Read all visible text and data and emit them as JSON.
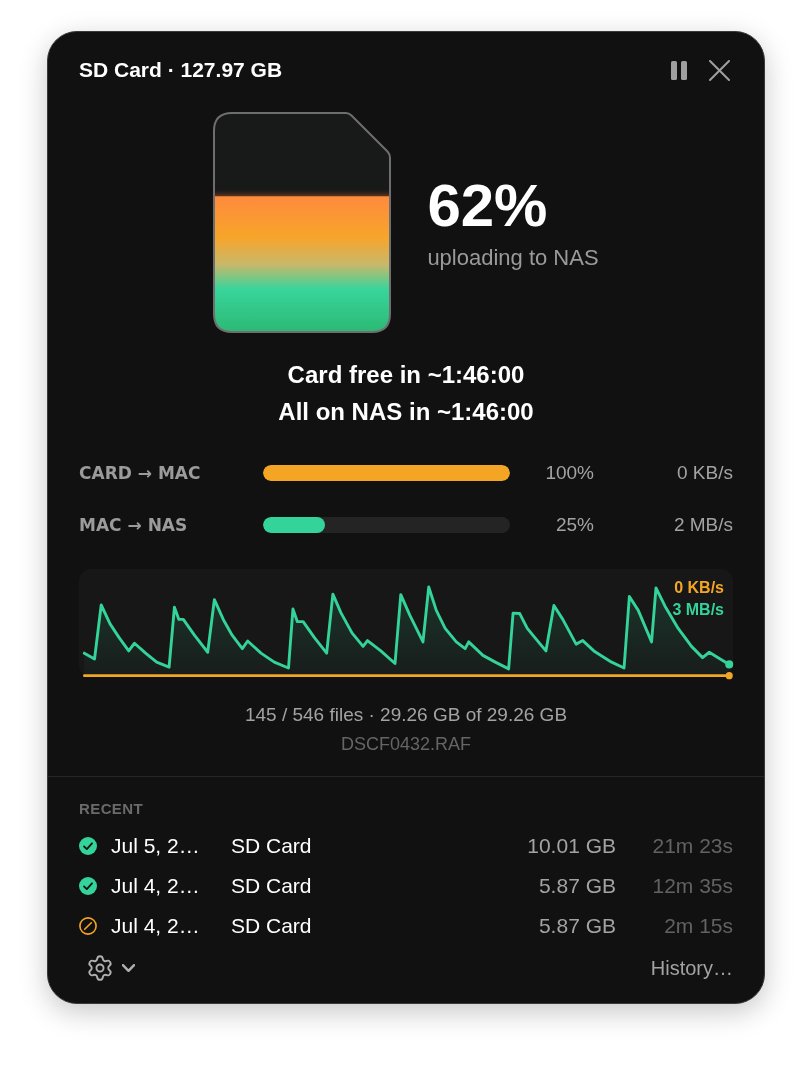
{
  "window": {
    "title": "SD Card · 127.97 GB"
  },
  "card": {
    "level": 0.62,
    "percent": "62%",
    "status": "uploading to NAS"
  },
  "estimates": [
    "Card free in ~1:46:00",
    "All on NAS in ~1:46:00"
  ],
  "transfers": [
    {
      "label": "CARD → MAC",
      "level": 1,
      "percent": "100%",
      "speed": "0 KB/s",
      "color": "#f5a524"
    },
    {
      "label": "MAC → NAS",
      "level": 0.25,
      "percent": "25%",
      "speed": "2 MB/s",
      "color": "#34d399"
    }
  ],
  "graph": {
    "series": [
      {
        "reading": "0 KB/s",
        "color": "#f5a524"
      },
      {
        "reading": "3 MB/s",
        "color": "#34d399"
      }
    ]
  },
  "progress": {
    "summary": "145 / 546 files · 29.26 GB of 29.26 GB",
    "current_file": "DSCF0432.RAF"
  },
  "recent": {
    "heading": "RECENT",
    "items": [
      {
        "kind": "completed",
        "date": "Jul 5, 2…",
        "source": "SD Card",
        "size": "10.01 GB",
        "duration": "21m 23s"
      },
      {
        "kind": "completed",
        "date": "Jul 4, 2…",
        "source": "SD Card",
        "size": "5.87 GB",
        "duration": "12m 35s"
      },
      {
        "kind": "cancelled",
        "date": "Jul 4, 2…",
        "source": "SD Card",
        "size": "5.87 GB",
        "duration": "2m 15s"
      }
    ]
  },
  "footer": {
    "link": "History…"
  }
}
